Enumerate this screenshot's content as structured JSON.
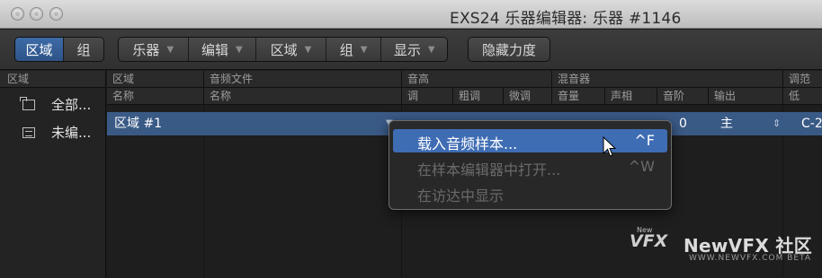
{
  "window": {
    "title": "EXS24 乐器编辑器: 乐器 #1146"
  },
  "toolbar": {
    "view_toggle": [
      {
        "label": "区域",
        "active": true
      },
      {
        "label": "组",
        "active": false
      }
    ],
    "menus": [
      "乐器",
      "编辑",
      "区域",
      "组",
      "显示"
    ],
    "hide_velocity": "隐藏力度"
  },
  "sidebar": {
    "header": "区域",
    "items": [
      {
        "label": "全部...",
        "icon": "folder-icon"
      },
      {
        "label": "未编...",
        "icon": "list-icon"
      }
    ]
  },
  "table": {
    "group_headers": [
      "区域",
      "音频文件",
      "音高",
      "混音器",
      "调范"
    ],
    "column_headers": [
      "名称",
      "名称",
      "调",
      "粗调",
      "微调",
      "音量",
      "声相",
      "音阶",
      "输出",
      "低"
    ],
    "rows": [
      {
        "name": "区域 #1",
        "scale": "0",
        "output": "主",
        "low": "C-2"
      }
    ]
  },
  "context_menu": {
    "items": [
      {
        "label": "载入音频样本...",
        "shortcut": "^F",
        "enabled": true,
        "highlighted": true
      },
      {
        "label": "在样本编辑器中打开...",
        "shortcut": "^W",
        "enabled": false,
        "highlighted": false
      },
      {
        "label": "在访达中显示",
        "shortcut": "",
        "enabled": false,
        "highlighted": false
      }
    ]
  },
  "watermark": {
    "logo": "VFX",
    "logo_small": "New",
    "brand": "NewVFX 社区",
    "url": "WWW.NEWVFX.COM BETA"
  },
  "colors": {
    "accent": "#3f6db4",
    "selected_row": "#3a5a86",
    "background": "#1c1c1c"
  }
}
